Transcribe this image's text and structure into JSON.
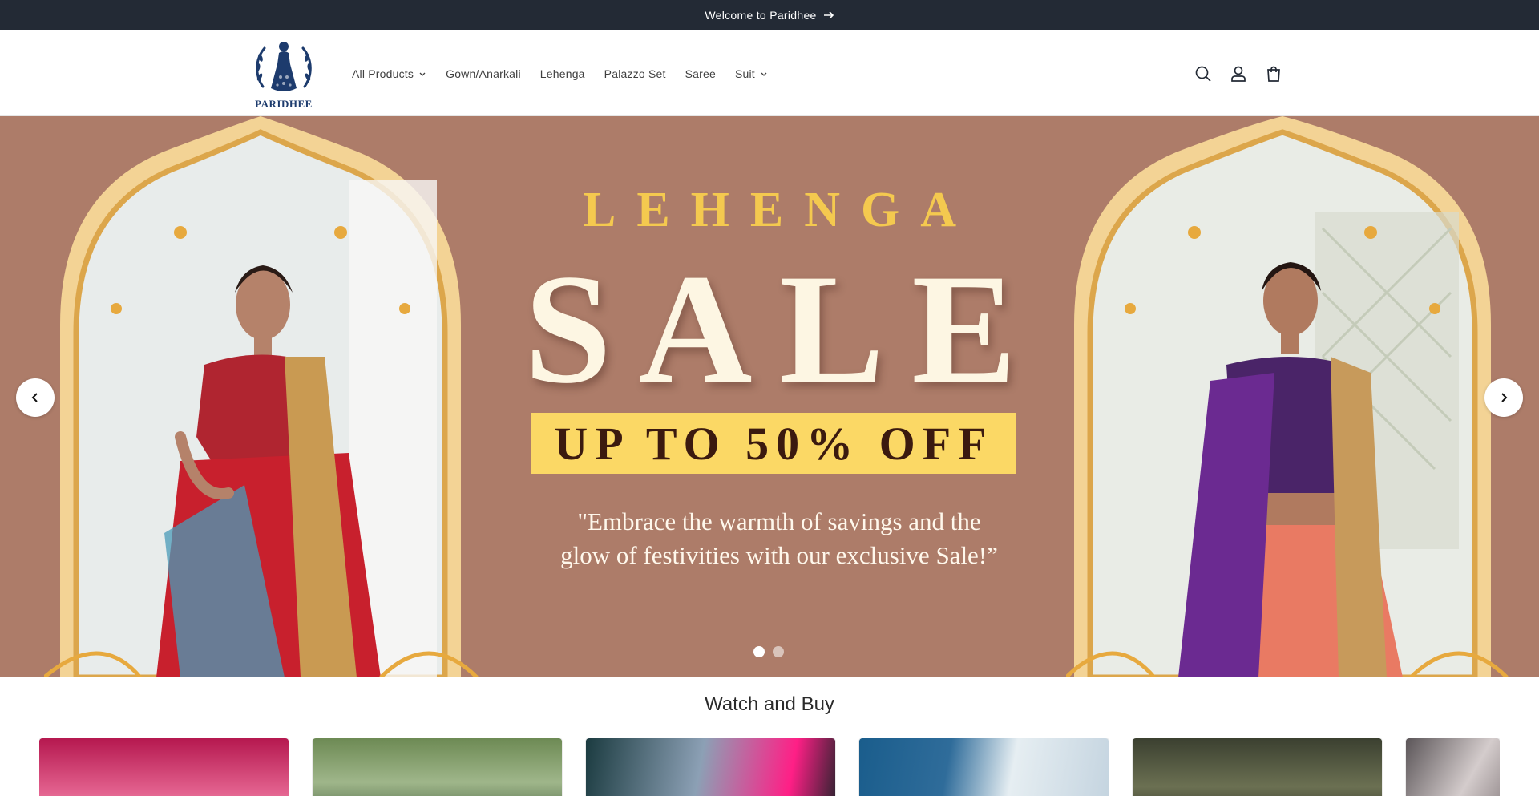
{
  "announcement": {
    "text": "Welcome to Paridhee"
  },
  "brand": {
    "name": "PARIDHEE",
    "color": "#1d3b6d"
  },
  "nav": {
    "items": [
      {
        "label": "All Products",
        "has_dropdown": true
      },
      {
        "label": "Gown/Anarkali",
        "has_dropdown": false
      },
      {
        "label": "Lehenga",
        "has_dropdown": false
      },
      {
        "label": "Palazzo Set",
        "has_dropdown": false
      },
      {
        "label": "Saree",
        "has_dropdown": false
      },
      {
        "label": "Suit",
        "has_dropdown": true
      }
    ]
  },
  "header_icons": [
    "search-icon",
    "account-icon",
    "cart-icon"
  ],
  "hero": {
    "background": "#ad7c69",
    "kicker": "LEHENGA",
    "headline": "SALE",
    "offer": "UP TO 50% OFF",
    "quote": "\"Embrace the warmth of savings and the glow of festivities with our exclusive Sale!”",
    "slide_count": 2,
    "active_slide": 1,
    "colors": {
      "gold": "#f4c94f",
      "badge": "#fbd865",
      "cream": "#fdf6e3"
    }
  },
  "watch_and_buy": {
    "title": "Watch and Buy",
    "cards": [
      {
        "theme": "#b5184f"
      },
      {
        "theme": "#6d8a54"
      },
      {
        "theme": "#1b3b40"
      },
      {
        "theme": "#1a5d8c"
      },
      {
        "theme": "#3b4030"
      },
      {
        "theme": "#5b5558"
      }
    ]
  }
}
